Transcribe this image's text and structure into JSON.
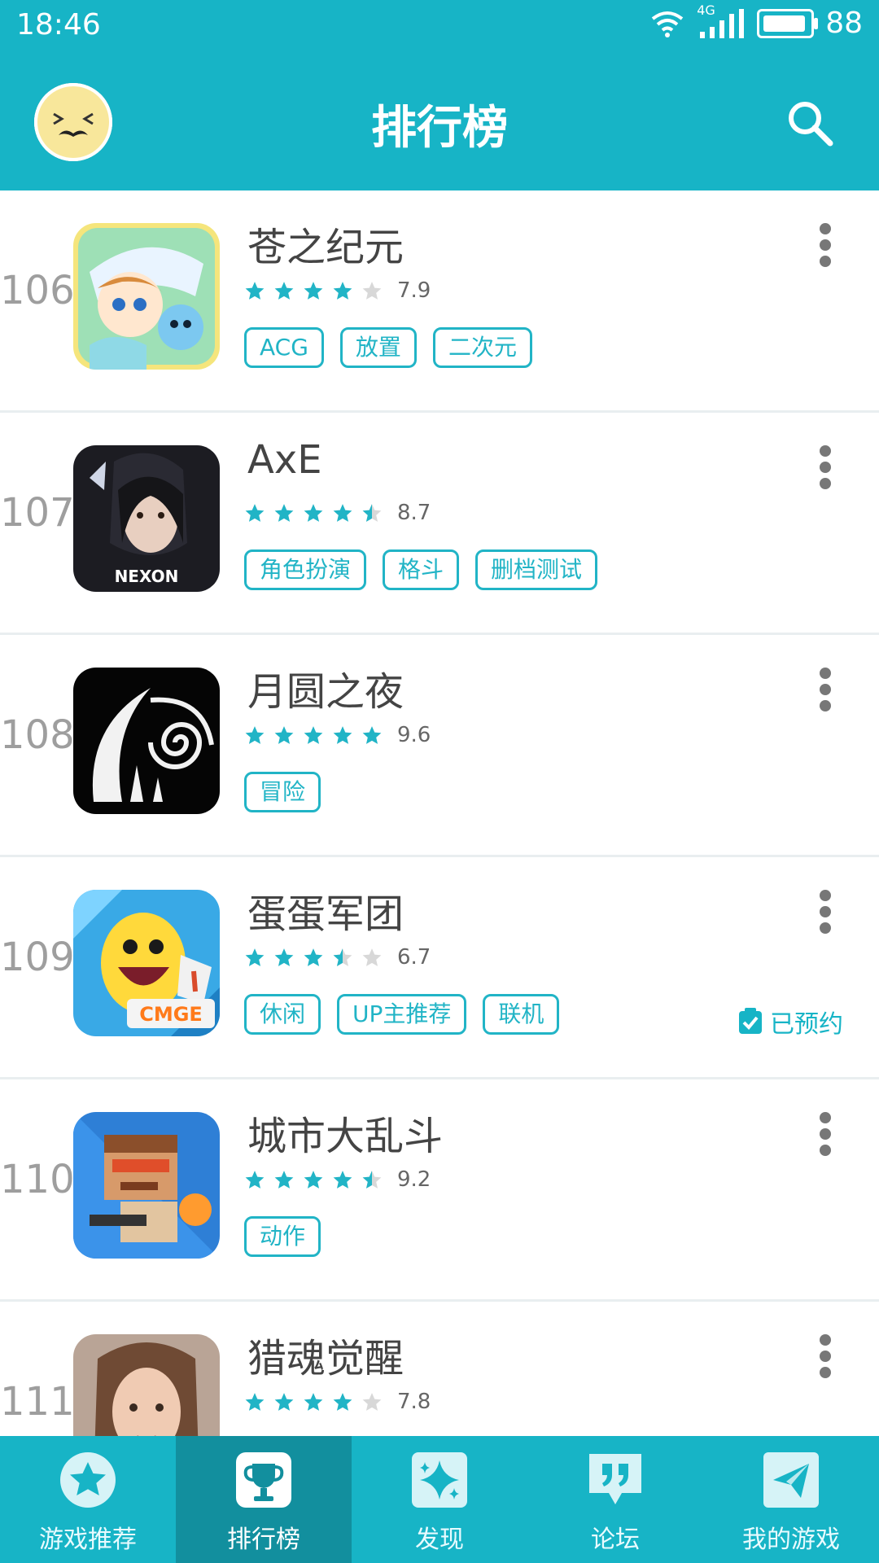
{
  "status_bar": {
    "time": "18:46",
    "network": "4G",
    "battery": "88"
  },
  "header": {
    "title": "排行榜",
    "avatar_icon": "mustache-face-avatar",
    "search_icon": "search-icon"
  },
  "list": {
    "items": [
      {
        "rank": "106",
        "name": "苍之纪元",
        "score": "7.9",
        "stars": 4,
        "tags": [
          "ACG",
          "放置",
          "二次元"
        ],
        "reserved": ""
      },
      {
        "rank": "107",
        "name": "AxE",
        "score": "8.7",
        "stars": 4.5,
        "tags": [
          "角色扮演",
          "格斗",
          "删档测试"
        ],
        "reserved": ""
      },
      {
        "rank": "108",
        "name": "月圆之夜",
        "score": "9.6",
        "stars": 5,
        "tags": [
          "冒险"
        ],
        "reserved": ""
      },
      {
        "rank": "109",
        "name": "蛋蛋军团",
        "score": "6.7",
        "stars": 3.5,
        "tags": [
          "休闲",
          "UP主推荐",
          "联机"
        ],
        "reserved": "已预约"
      },
      {
        "rank": "110",
        "name": "城市大乱斗",
        "score": "9.2",
        "stars": 4.5,
        "tags": [
          "动作"
        ],
        "reserved": ""
      },
      {
        "rank": "111",
        "name": "猎魂觉醒",
        "score": "7.8",
        "stars": 4,
        "tags": [],
        "reserved": ""
      }
    ]
  },
  "bottom_nav": {
    "items": [
      {
        "label": "游戏推荐",
        "icon": "star-icon",
        "active": false
      },
      {
        "label": "排行榜",
        "icon": "trophy-icon",
        "active": true
      },
      {
        "label": "发现",
        "icon": "sparkle-icon",
        "active": false
      },
      {
        "label": "论坛",
        "icon": "quote-bubble-icon",
        "active": false
      },
      {
        "label": "我的游戏",
        "icon": "paper-plane-icon",
        "active": false
      }
    ]
  },
  "colors": {
    "primary": "#17b4c6",
    "active_tab": "#128f9e",
    "star": "#21b4c6",
    "star_empty": "#d8d8d8"
  }
}
